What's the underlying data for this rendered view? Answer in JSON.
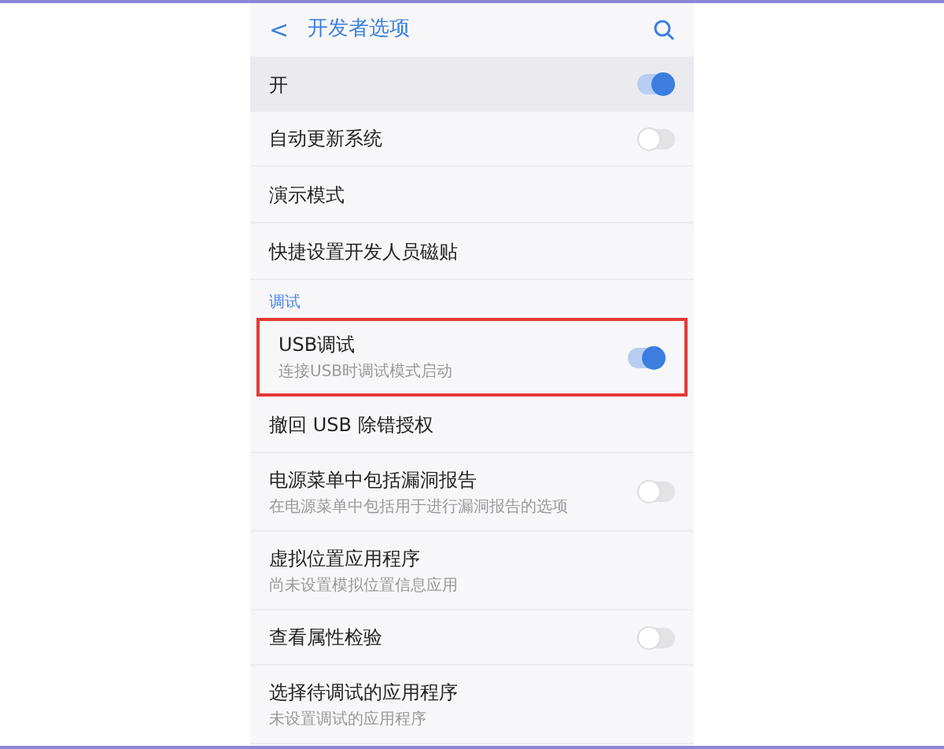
{
  "header": {
    "back": "<",
    "title": "开发者选项"
  },
  "rows": [
    {
      "kind": "toggle",
      "title": "开",
      "on": true,
      "highlighted": false
    },
    {
      "kind": "toggle",
      "title": "自动更新系统",
      "on": false,
      "highlighted": false
    },
    {
      "kind": "link",
      "title": "演示模式",
      "highlighted": false
    },
    {
      "kind": "link",
      "title": "快捷设置开发人员磁贴",
      "highlighted": false
    },
    {
      "kind": "section",
      "title": "调试"
    },
    {
      "kind": "toggle",
      "title": "USB调试",
      "subtitle": "连接USB时调试模式启动",
      "on": true,
      "highlighted": true
    },
    {
      "kind": "link",
      "title": "撤回 USB 除错授权",
      "highlighted": false
    },
    {
      "kind": "toggle",
      "title": "电源菜单中包括漏洞报告",
      "subtitle": "在电源菜单中包括用于进行漏洞报告的选项",
      "on": false,
      "highlighted": false
    },
    {
      "kind": "link",
      "title": "虚拟位置应用程序",
      "subtitle": "尚未设置模拟位置信息应用",
      "highlighted": false
    },
    {
      "kind": "toggle",
      "title": "查看属性检验",
      "on": false,
      "highlighted": false
    },
    {
      "kind": "link",
      "title": "选择待调试的应用程序",
      "subtitle": "未设置调试的应用程序",
      "highlighted": false
    }
  ]
}
